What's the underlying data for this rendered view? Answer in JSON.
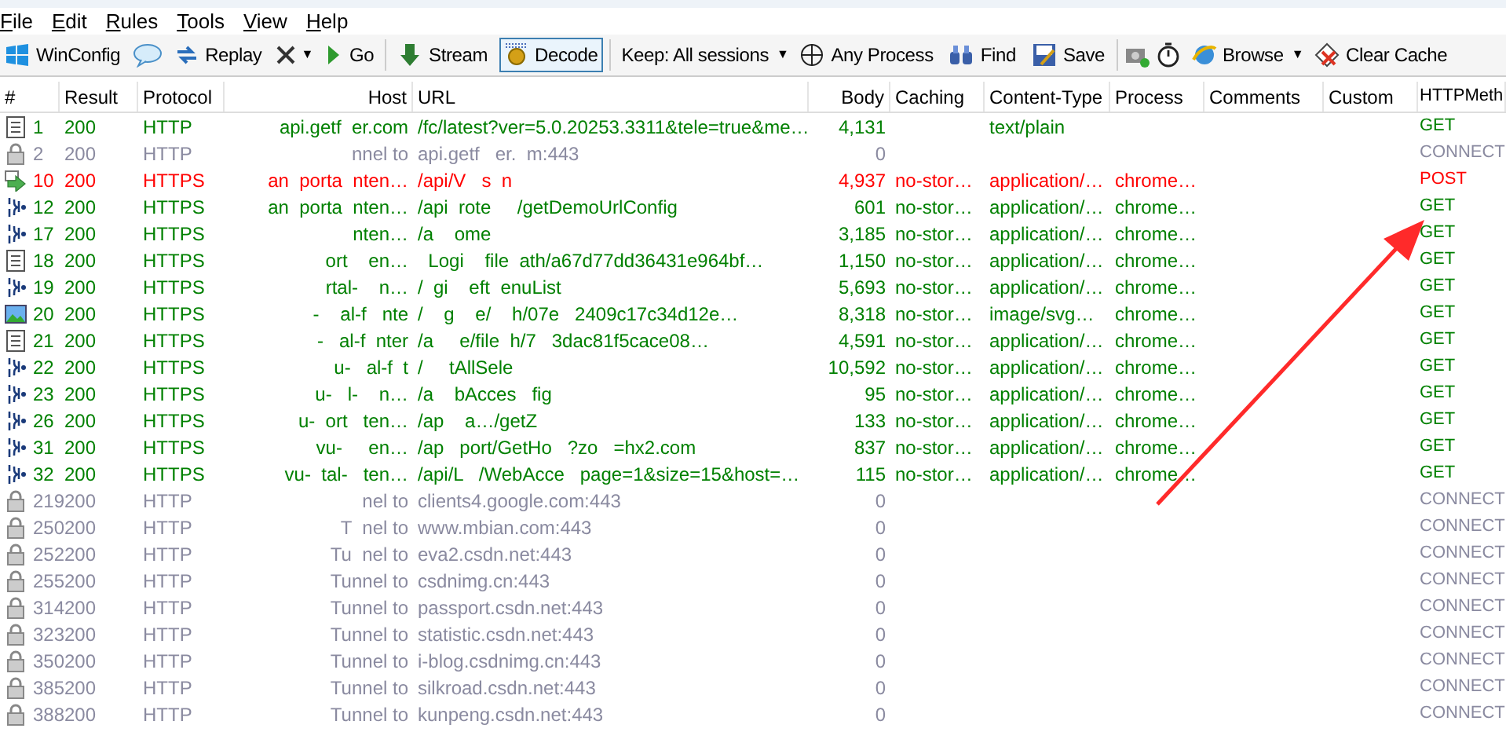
{
  "menu": [
    "File",
    "Edit",
    "Rules",
    "Tools",
    "View",
    "Help"
  ],
  "toolbar": [
    {
      "kind": "windows",
      "label": "WinConfig"
    },
    {
      "kind": "comment"
    },
    {
      "kind": "replay",
      "label": "Replay"
    },
    {
      "kind": "remove",
      "caret": "▼"
    },
    {
      "kind": "go",
      "label": "Go"
    },
    {
      "kind": "sep"
    },
    {
      "kind": "stream",
      "label": "Stream",
      "selected": false
    },
    {
      "kind": "decode",
      "label": "Decode",
      "selected": true
    },
    {
      "kind": "sep"
    },
    {
      "kind": "keep",
      "label": "Keep: All sessions",
      "caret": "▼"
    },
    {
      "kind": "process",
      "label": "Any Process"
    },
    {
      "kind": "find",
      "label": "Find"
    },
    {
      "kind": "save",
      "label": "Save"
    },
    {
      "kind": "sep"
    },
    {
      "kind": "camera"
    },
    {
      "kind": "timer"
    },
    {
      "kind": "browse",
      "label": "Browse",
      "caret": "▼"
    },
    {
      "kind": "clear",
      "label": "Clear Cache"
    }
  ],
  "table": {
    "columns": [
      "#",
      "Result",
      "Protocol",
      "Host",
      "URL",
      "Body",
      "Caching",
      "Content-Type",
      "Process",
      "Comments",
      "Custom",
      "HTTPMeth"
    ],
    "rows": [
      {
        "kind": "text",
        "num": "1",
        "result": "200",
        "protocol": "HTTP",
        "host": "api.getf  er.com",
        "url": "/fc/latest?ver=5.0.20253.3311&tele=true&me…",
        "body": "4,131",
        "content_type": "text/plain",
        "method": "GET"
      },
      {
        "kind": "lock",
        "num": "2",
        "result": "200",
        "protocol": "HTTP",
        "host": "nnel to",
        "url": "api.getf   er.  m:443",
        "body": "0",
        "method": "CONNECT"
      },
      {
        "kind": "post",
        "num": "10",
        "result": "200",
        "protocol": "HTTPS",
        "host": "an  porta  nten…",
        "url": "/api/V   s  n",
        "body": "4,937",
        "caching": "no-stor…",
        "content_type": "application/…",
        "process": "chrome…",
        "method": "POST"
      },
      {
        "kind": "json",
        "num": "12",
        "result": "200",
        "protocol": "HTTPS",
        "host": "an  porta  nten…",
        "url": "/api  rote     /getDemoUrlConfig",
        "body": "601",
        "caching": "no-stor…",
        "content_type": "application/…",
        "process": "chrome…",
        "method": "GET"
      },
      {
        "kind": "json",
        "num": "17",
        "result": "200",
        "protocol": "HTTPS",
        "host": "  nten…",
        "url": "/a    ome",
        "body": "3,185",
        "caching": "no-stor…",
        "content_type": "application/…",
        "process": "chrome…",
        "method": "GET"
      },
      {
        "kind": "text",
        "num": "18",
        "result": "200",
        "protocol": "HTTPS",
        "host": "  ort    en…",
        "url": "  Logi    file  ath/a67d77dd36431e964bf…",
        "body": "1,150",
        "caching": "no-stor…",
        "content_type": "application/…",
        "process": "chrome…",
        "method": "GET"
      },
      {
        "kind": "json",
        "num": "19",
        "result": "200",
        "protocol": "HTTPS",
        "host": "  rtal-    n…",
        "url": "/  gi    eft  enuList",
        "body": "5,693",
        "caching": "no-stor…",
        "content_type": "application/…",
        "process": "chrome…",
        "method": "GET"
      },
      {
        "kind": "image",
        "num": "20",
        "result": "200",
        "protocol": "HTTPS",
        "host": "  -    al-f   nte",
        "url": "/    g    e/    h/07e   2409c17c34d12e…",
        "body": "8,318",
        "caching": "no-stor…",
        "content_type": "image/svg…",
        "process": "chrome…",
        "method": "GET"
      },
      {
        "kind": "text",
        "num": "21",
        "result": "200",
        "protocol": "HTTPS",
        "host": "  -   al-f  nter",
        "url": "/a     e/file  h/7   3dac81f5cace08…",
        "body": "4,591",
        "caching": "no-stor…",
        "content_type": "application/…",
        "process": "chrome…",
        "method": "GET"
      },
      {
        "kind": "json",
        "num": "22",
        "result": "200",
        "protocol": "HTTPS",
        "host": "  u-   al-f  t",
        "url": "/     tAllSele",
        "body": "10,592",
        "caching": "no-stor…",
        "content_type": "application/…",
        "process": "chrome…",
        "method": "GET"
      },
      {
        "kind": "json",
        "num": "23",
        "result": "200",
        "protocol": "HTTPS",
        "host": "  u-   l-    n…",
        "url": "/a    bAcces   fig",
        "body": "95",
        "caching": "no-stor…",
        "content_type": "application/…",
        "process": "chrome…",
        "method": "GET"
      },
      {
        "kind": "json",
        "num": "26",
        "result": "200",
        "protocol": "HTTPS",
        "host": "  u-  ort   ten…",
        "url": "/ap    a…/getZ",
        "body": "133",
        "caching": "no-stor…",
        "content_type": "application/…",
        "process": "chrome…",
        "method": "GET"
      },
      {
        "kind": "json",
        "num": "31",
        "result": "200",
        "protocol": "HTTPS",
        "host": "  vu-     en…",
        "url": "/ap   port/GetHo   ?zo   =hx2.com",
        "body": "837",
        "caching": "no-stor…",
        "content_type": "application/…",
        "process": "chrome…",
        "method": "GET"
      },
      {
        "kind": "json",
        "num": "32",
        "result": "200",
        "protocol": "HTTPS",
        "host": "  vu-  tal-   ten…",
        "url": "/api/L   /WebAcce   page=1&size=15&host=…",
        "body": "115",
        "caching": "no-stor…",
        "content_type": "application/…",
        "process": "chrome…",
        "method": "GET"
      },
      {
        "kind": "lock",
        "num": "219",
        "result": "200",
        "protocol": "HTTP",
        "host": "nel to",
        "url": "clients4.google.com:443",
        "body": "0",
        "method": "CONNECT"
      },
      {
        "kind": "lock",
        "num": "250",
        "result": "200",
        "protocol": "HTTP",
        "host": "T  nel to",
        "url": "www.mbian.com:443",
        "body": "0",
        "method": "CONNECT"
      },
      {
        "kind": "lock",
        "num": "252",
        "result": "200",
        "protocol": "HTTP",
        "host": "Tu  nel to",
        "url": "eva2.csdn.net:443",
        "body": "0",
        "method": "CONNECT"
      },
      {
        "kind": "lock",
        "num": "255",
        "result": "200",
        "protocol": "HTTP",
        "host": "Tunnel to",
        "url": "csdnimg.cn:443",
        "body": "0",
        "method": "CONNECT"
      },
      {
        "kind": "lock",
        "num": "314",
        "result": "200",
        "protocol": "HTTP",
        "host": "Tunnel to",
        "url": "passport.csdn.net:443",
        "body": "0",
        "method": "CONNECT"
      },
      {
        "kind": "lock",
        "num": "323",
        "result": "200",
        "protocol": "HTTP",
        "host": "Tunnel to",
        "url": "statistic.csdn.net:443",
        "body": "0",
        "method": "CONNECT"
      },
      {
        "kind": "lock",
        "num": "350",
        "result": "200",
        "protocol": "HTTP",
        "host": "Tunnel to",
        "url": "i-blog.csdnimg.cn:443",
        "body": "0",
        "method": "CONNECT"
      },
      {
        "kind": "lock",
        "num": "385",
        "result": "200",
        "protocol": "HTTP",
        "host": "Tunnel to",
        "url": "silkroad.csdn.net:443",
        "body": "0",
        "method": "CONNECT"
      },
      {
        "kind": "lock",
        "num": "388",
        "result": "200",
        "protocol": "HTTP",
        "host": "Tunnel to",
        "url": "kunpeng.csdn.net:443",
        "body": "0",
        "method": "CONNECT"
      }
    ]
  },
  "annotation": {
    "kind": "arrow"
  }
}
